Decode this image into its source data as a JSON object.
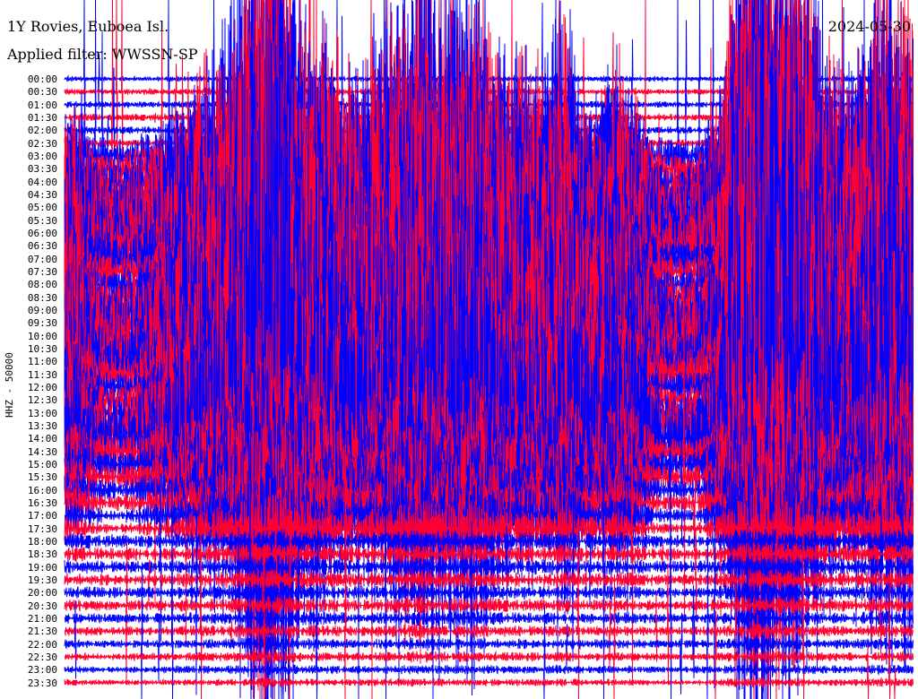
{
  "chart_data": {
    "type": "line",
    "title": "1Y Rovies, Euboea Isl.",
    "subtitle": "Applied filter: WWSSN-SP",
    "date": "2024-05-30",
    "ylabel": "HHZ - 50000",
    "row_labels": [
      "00:00",
      "00:30",
      "01:00",
      "01:30",
      "02:00",
      "02:30",
      "03:00",
      "03:30",
      "04:00",
      "04:30",
      "05:00",
      "05:30",
      "06:00",
      "06:30",
      "07:00",
      "07:30",
      "08:00",
      "08:30",
      "09:00",
      "09:30",
      "10:00",
      "10:30",
      "11:00",
      "11:30",
      "12:00",
      "12:30",
      "13:00",
      "13:30",
      "14:00",
      "14:30",
      "15:00",
      "15:30",
      "16:00",
      "16:30",
      "17:00",
      "17:30",
      "18:00",
      "18:30",
      "19:00",
      "19:30",
      "20:00",
      "20:30",
      "21:00",
      "21:30",
      "22:00",
      "22:30",
      "23:00",
      "23:30"
    ],
    "series_colors": [
      "#0000ff",
      "#ff0033"
    ]
  }
}
